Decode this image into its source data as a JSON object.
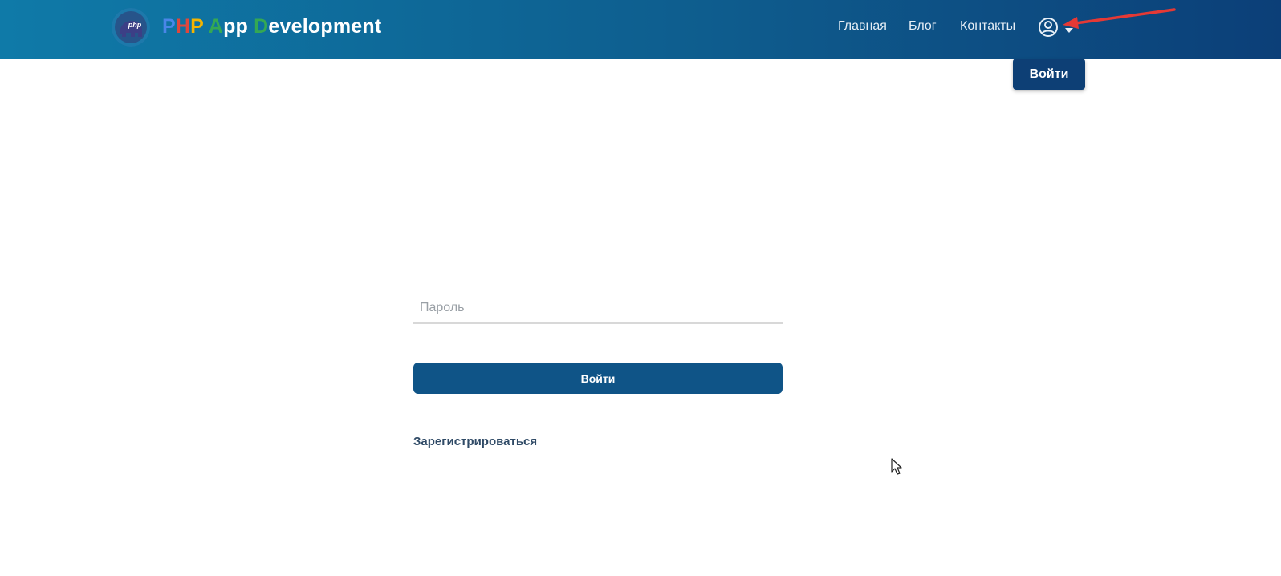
{
  "header": {
    "brand": {
      "parts": [
        {
          "text": "P",
          "color": "#4a86e8"
        },
        {
          "text": "H",
          "color": "#e0473c"
        },
        {
          "text": "P",
          "color": "#f4b400"
        },
        {
          "text": " ",
          "color": "#ffffff"
        },
        {
          "text": "A",
          "color": "#34a853"
        },
        {
          "text": "pp ",
          "color": "#ffffff"
        },
        {
          "text": "D",
          "color": "#34a853"
        },
        {
          "text": "evelopment",
          "color": "#ffffff"
        }
      ]
    },
    "logo_text": "php",
    "nav": [
      {
        "label": "Главная"
      },
      {
        "label": "Блог"
      },
      {
        "label": "Контакты"
      }
    ],
    "user_icon": "user-circle-icon",
    "dropdown_icon": "caret-down-icon",
    "login_popup_label": "Войти"
  },
  "form": {
    "password_placeholder": "Пароль",
    "password_value": "",
    "submit_label": "Войти",
    "register_label": "Зарегистрироваться"
  },
  "colors": {
    "header_start": "#0f7aa8",
    "header_end": "#0c3f78",
    "primary_button": "#0f5487",
    "popup_button": "#0d3f75",
    "annotation_arrow": "#e53935"
  }
}
